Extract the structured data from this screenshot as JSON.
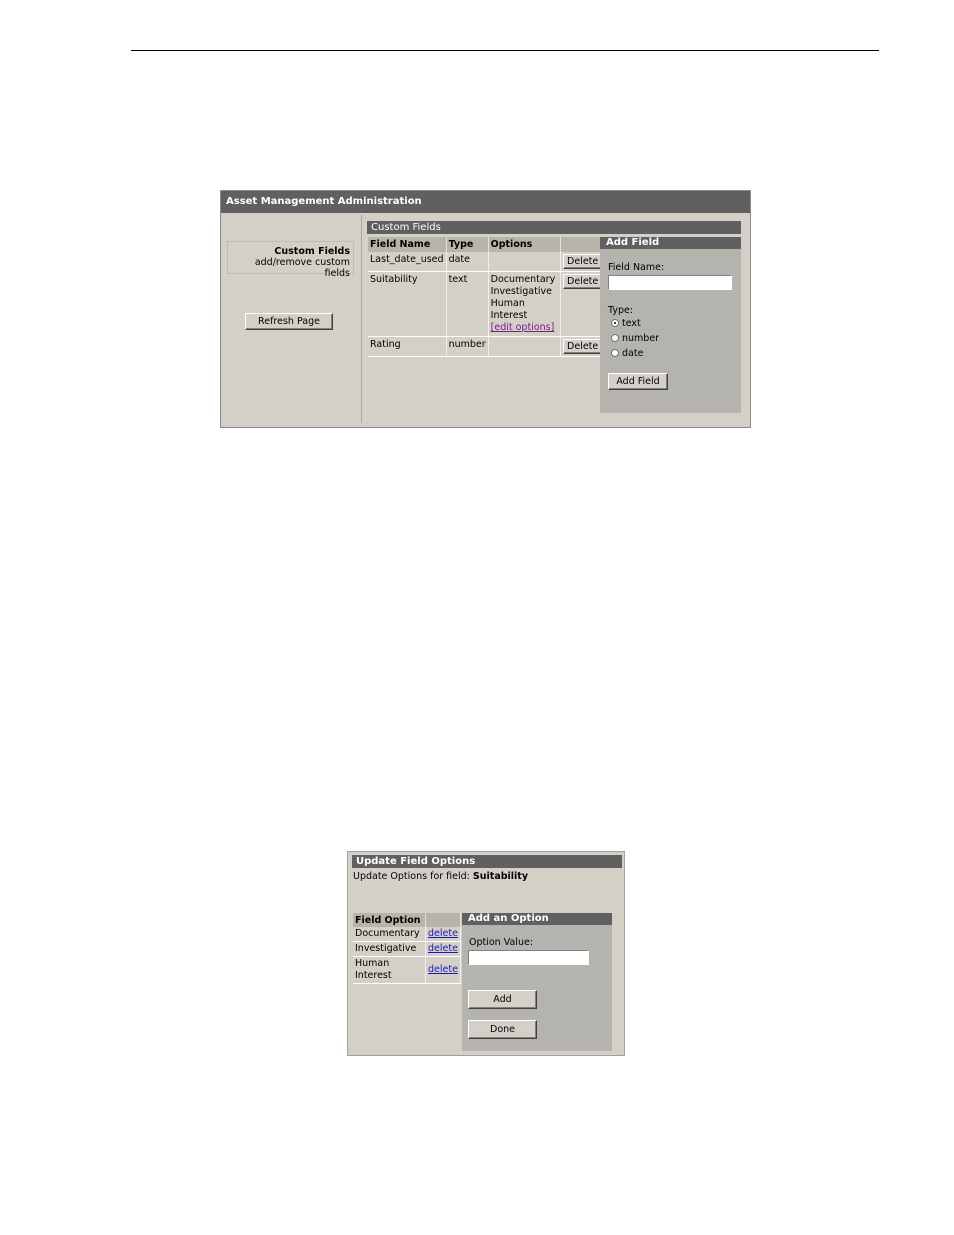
{
  "admin": {
    "title": "Asset Management Administration",
    "nav": {
      "title": "Custom Fields",
      "subtitle": "add/remove custom fields"
    },
    "refresh_label": "Refresh Page",
    "custom_fields": {
      "heading": "Custom Fields",
      "columns": [
        "Field Name",
        "Type",
        "Options",
        ""
      ],
      "rows": [
        {
          "name": "Last_date_used",
          "type": "date",
          "options": [],
          "edit_link": "",
          "action": "Delete"
        },
        {
          "name": "Suitability",
          "type": "text",
          "options": [
            "Documentary",
            "Investigative",
            "Human Interest"
          ],
          "edit_link": "[edit options]",
          "action": "Delete"
        },
        {
          "name": "Rating",
          "type": "number",
          "options": [],
          "edit_link": "",
          "action": "Delete"
        }
      ]
    },
    "add_field": {
      "heading": "Add Field",
      "name_label": "Field Name:",
      "name_value": "",
      "type_label": "Type:",
      "types": [
        "text",
        "number",
        "date"
      ],
      "selected_type": "text",
      "button_label": "Add Field"
    }
  },
  "update": {
    "title": "Update Field Options",
    "subtitle_prefix": "Update Options for field:",
    "field_name": "Suitability",
    "option_column": "Field Option",
    "options": [
      {
        "value": "Documentary",
        "action": "delete"
      },
      {
        "value": "Investigative",
        "action": "delete"
      },
      {
        "value": "Human Interest",
        "action": "delete"
      }
    ],
    "add_option": {
      "heading": "Add an Option",
      "value_label": "Option Value:",
      "value": "",
      "add_label": "Add",
      "done_label": "Done"
    }
  }
}
